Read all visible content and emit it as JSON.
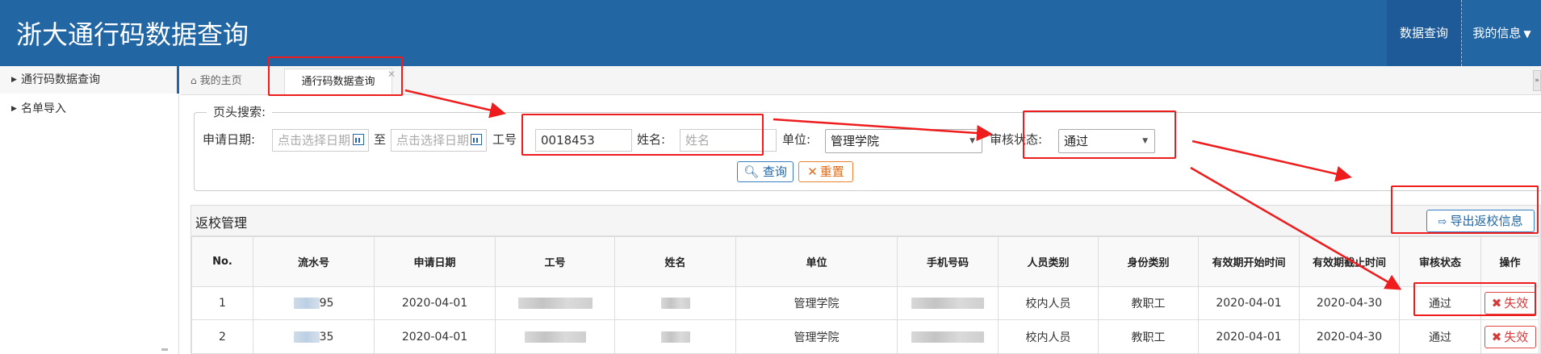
{
  "header": {
    "title": "浙大通行码数据查询",
    "nav_query": "数据查询",
    "nav_info": "我的信息"
  },
  "sidebar": {
    "items": [
      {
        "label": "通行码数据查询"
      },
      {
        "label": "名单导入"
      }
    ]
  },
  "tabs": {
    "home": "我的主页",
    "active": "通行码数据查询"
  },
  "search": {
    "legend": "页头搜索:",
    "date_label": "申请日期:",
    "date_from_placeholder": "点击选择日期",
    "to_label": "至",
    "date_to_placeholder": "点击选择日期",
    "id_label": "工号",
    "id_value": "0018453",
    "name_label": "姓名:",
    "name_placeholder": "姓名",
    "unit_label": "单位:",
    "unit_value": "管理学院",
    "status_label": "审核状态:",
    "status_value": "通过",
    "query_button": "查询",
    "reset_button": "重置"
  },
  "panel": {
    "title": "返校管理",
    "export_button": "导出返校信息"
  },
  "table": {
    "headers": [
      "No.",
      "流水号",
      "申请日期",
      "工号",
      "姓名",
      "单位",
      "手机号码",
      "人员类别",
      "身份类别",
      "有效期开始时间",
      "有效期截止时间",
      "审核状态",
      "操作"
    ],
    "rows": [
      {
        "no": "1",
        "serial": "95",
        "date": "2020-04-01",
        "unit": "管理学院",
        "person_type": "校内人员",
        "identity": "教职工",
        "valid_from": "2020-04-01",
        "valid_to": "2020-04-30",
        "status": "通过",
        "action": "失效"
      },
      {
        "no": "2",
        "serial": "35",
        "date": "2020-04-01",
        "unit": "管理学院",
        "person_type": "校内人员",
        "identity": "教职工",
        "valid_from": "2020-04-01",
        "valid_to": "2020-04-30",
        "status": "通过",
        "action": "失效"
      }
    ]
  },
  "colors": {
    "header_bg": "#2266a4",
    "annotation": "#ee1c1c"
  }
}
